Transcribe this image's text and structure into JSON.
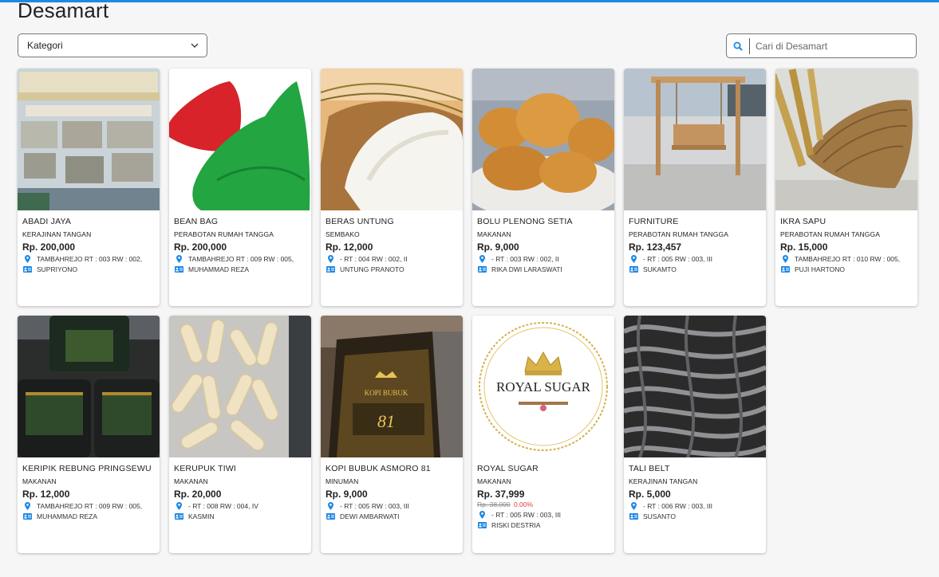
{
  "page": {
    "title": "Desamart"
  },
  "filters": {
    "kategori_label": "Kategori",
    "search_placeholder": "Cari di Desamart"
  },
  "products": [
    {
      "name": "ABADI JAYA",
      "category": "KERAJINAN TANGAN",
      "price": "Rp. 200,000",
      "address": "TAMBAHREJO RT : 003 RW : 002,",
      "seller": "SUPRIYONO",
      "image": "billboard-sign-image"
    },
    {
      "name": "BEAN BAG",
      "category": "PERABOTAN RUMAH TANGGA",
      "price": "Rp. 200,000",
      "address": "TAMBAHREJO RT : 009 RW : 005,",
      "seller": "MUHAMMAD REZA",
      "image": "bean-bag-image"
    },
    {
      "name": "BERAS UNTUNG",
      "category": "SEMBAKO",
      "price": "Rp. 12,000",
      "address": "- RT : 004 RW : 002, II",
      "seller": "UNTUNG PRANOTO",
      "image": "rice-image"
    },
    {
      "name": "BOLU PLENONG SETIA",
      "category": "MAKANAN",
      "price": "Rp. 9,000",
      "address": "- RT : 003 RW : 002, II",
      "seller": "RIKA DWI LARASWATI",
      "image": "cake-image"
    },
    {
      "name": "FURNITURE",
      "category": "PERABOTAN RUMAH TANGGA",
      "price": "Rp. 123,457",
      "address": "- RT : 005 RW : 003, III",
      "seller": "SUKAMTO",
      "image": "swing-bench-image"
    },
    {
      "name": "IKRA SAPU",
      "category": "PERABOTAN RUMAH TANGGA",
      "price": "Rp. 15,000",
      "address": "TAMBAHREJO RT : 010 RW : 005,",
      "seller": "PUJI HARTONO",
      "image": "bamboo-basket-image"
    },
    {
      "name": "KERIPIK REBUNG PRINGSEWU",
      "category": "MAKANAN",
      "price": "Rp. 12,000",
      "address": "TAMBAHREJO RT : 009 RW : 005,",
      "seller": "MUHAMMAD REZA",
      "image": "snack-jars-image"
    },
    {
      "name": "KERUPUK TIWI",
      "category": "MAKANAN",
      "price": "Rp. 20,000",
      "address": "- RT : 008 RW : 004, IV",
      "seller": "KASMIN",
      "image": "crackers-image"
    },
    {
      "name": "KOPI BUBUK ASMORO 81",
      "category": "MINUMAN",
      "price": "Rp. 9,000",
      "address": "- RT : 005 RW : 003, III",
      "seller": "DEWI AMBARWATI",
      "image": "coffee-pack-image",
      "pack_text": [
        "KOPI BUBUK",
        "81"
      ]
    },
    {
      "name": "ROYAL SUGAR",
      "category": "MAKANAN",
      "price": "Rp. 37,999",
      "old_price": "Rp. 38,000",
      "discount": "0.00%",
      "address": "- RT : 005 RW : 003, III",
      "seller": "RISKI DESTRIA",
      "image": "royal-sugar-logo-image",
      "logo_text": "ROYAL SUGAR"
    },
    {
      "name": "TALI BELT",
      "category": "KERAJINAN TANGAN",
      "price": "Rp. 5,000",
      "address": "- RT : 006 RW : 003, III",
      "seller": "SUSANTO",
      "image": "belt-straps-image"
    }
  ],
  "colors": {
    "accent": "#1e88e5",
    "icon": "#1e88e5",
    "discount": "#e53935"
  }
}
